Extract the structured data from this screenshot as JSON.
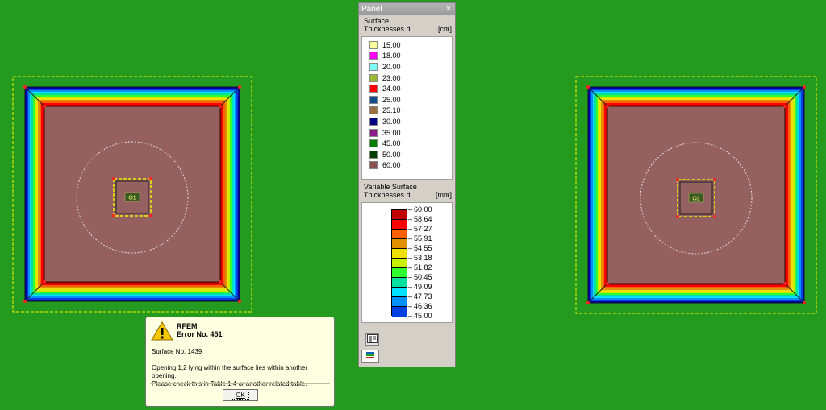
{
  "panel": {
    "title": "Panel",
    "close_glyph": "×",
    "surface_section": {
      "title_line1": "Surface",
      "title_line2": "Thicknesses d",
      "unit": "[cm]",
      "items": [
        {
          "value": "15.00",
          "color": "#ffff9c"
        },
        {
          "value": "18.00",
          "color": "#ff00ff"
        },
        {
          "value": "20.00",
          "color": "#80ffff"
        },
        {
          "value": "23.00",
          "color": "#9aba38"
        },
        {
          "value": "24.00",
          "color": "#ff0000"
        },
        {
          "value": "25.00",
          "color": "#104e8b"
        },
        {
          "value": "25.10",
          "color": "#9a7040"
        },
        {
          "value": "30.00",
          "color": "#000080"
        },
        {
          "value": "35.00",
          "color": "#8b1a8b"
        },
        {
          "value": "45.00",
          "color": "#008000"
        },
        {
          "value": "50.00",
          "color": "#004000"
        },
        {
          "value": "60.00",
          "color": "#8b5050"
        }
      ]
    },
    "variable_section": {
      "title_line1": "Variable Surface",
      "title_line2": "Thicknesses d",
      "unit": "[mm]",
      "labels": [
        "60.00",
        "58.64",
        "57.27",
        "55.91",
        "54.55",
        "53.18",
        "51.82",
        "50.45",
        "49.09",
        "47.73",
        "46.36",
        "45.00"
      ],
      "colors": [
        "#c00000",
        "#ff0000",
        "#ff6000",
        "#e09000",
        "#f0e000",
        "#c8f000",
        "#30ff30",
        "#00e0a0",
        "#00e0ff",
        "#0090ff",
        "#0040e0",
        "#0000a0"
      ]
    },
    "tab_icon": "panel-layers-icon"
  },
  "dialog": {
    "app": "RFEM",
    "error": "Error No. 451",
    "surface": "Surface No. 1439",
    "message_line1": "Opening 1,2 lying within the surface lies within another opening.",
    "message_line2": "Please check this in Table 1.4 or another related table.",
    "ok_label": "OK",
    "icon": "warning-icon"
  },
  "model": {
    "openings": [
      {
        "label": "O1"
      },
      {
        "label": "O2"
      }
    ],
    "background_color": "#249a1e",
    "slab_color": "#956060",
    "gradient_colors": [
      "#0000a0",
      "#0040e0",
      "#0090ff",
      "#00e0ff",
      "#00e0a0",
      "#30ff30",
      "#c8f000",
      "#f0e000",
      "#e09000",
      "#ff6000",
      "#ff0000",
      "#c00000"
    ]
  }
}
